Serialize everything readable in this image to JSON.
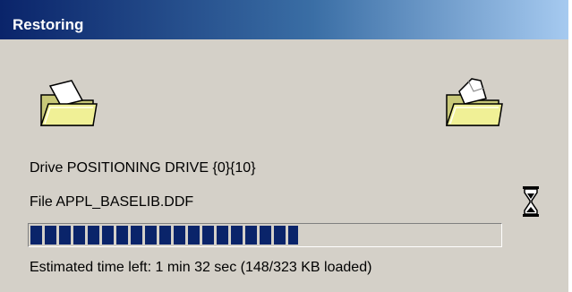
{
  "window": {
    "title": "Restoring"
  },
  "icons": {
    "source": "open-folder-icon",
    "destination": "open-folder-with-document-icon",
    "busy": "hourglass-icon"
  },
  "status": {
    "drive_line": "Drive POSITIONING DRIVE {0}{10}",
    "file_line": "File APPL_BASELIB.DDF",
    "estimate_line": "Estimated time left: 1 min 32 sec (148/323 KB loaded)"
  },
  "progress": {
    "loaded_kb": 148,
    "total_kb": 323,
    "fraction": 0.57
  },
  "colors": {
    "title_gradient_start": "#0a246a",
    "title_gradient_end": "#a6caf0",
    "progress_fill": "#0a246a",
    "window_background": "#d4d0c8"
  }
}
